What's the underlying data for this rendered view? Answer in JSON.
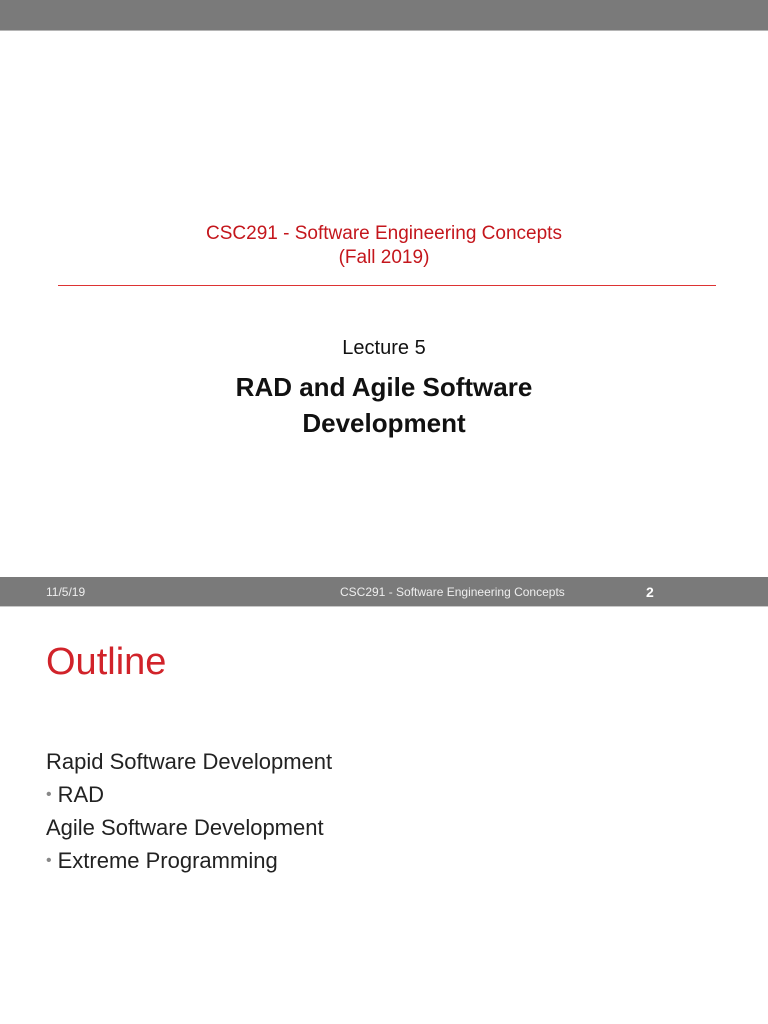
{
  "slide1": {
    "course_line1": "CSC291 - Software Engineering Concepts",
    "course_line2": "(Fall 2019)",
    "lecture": "Lecture 5",
    "title_line1": "RAD and Agile Software",
    "title_line2": "Development"
  },
  "footer": {
    "date": "11/5/19",
    "course": "CSC291 - Software Engineering Concepts",
    "page": "2"
  },
  "slide2": {
    "heading": "Outline",
    "items": [
      {
        "text": "Rapid Software Development",
        "bullet": false
      },
      {
        "text": "RAD",
        "bullet": true
      },
      {
        "text": "Agile Software Development",
        "bullet": false
      },
      {
        "text": "Extreme Programming",
        "bullet": true
      }
    ],
    "bullet_char": "•"
  }
}
